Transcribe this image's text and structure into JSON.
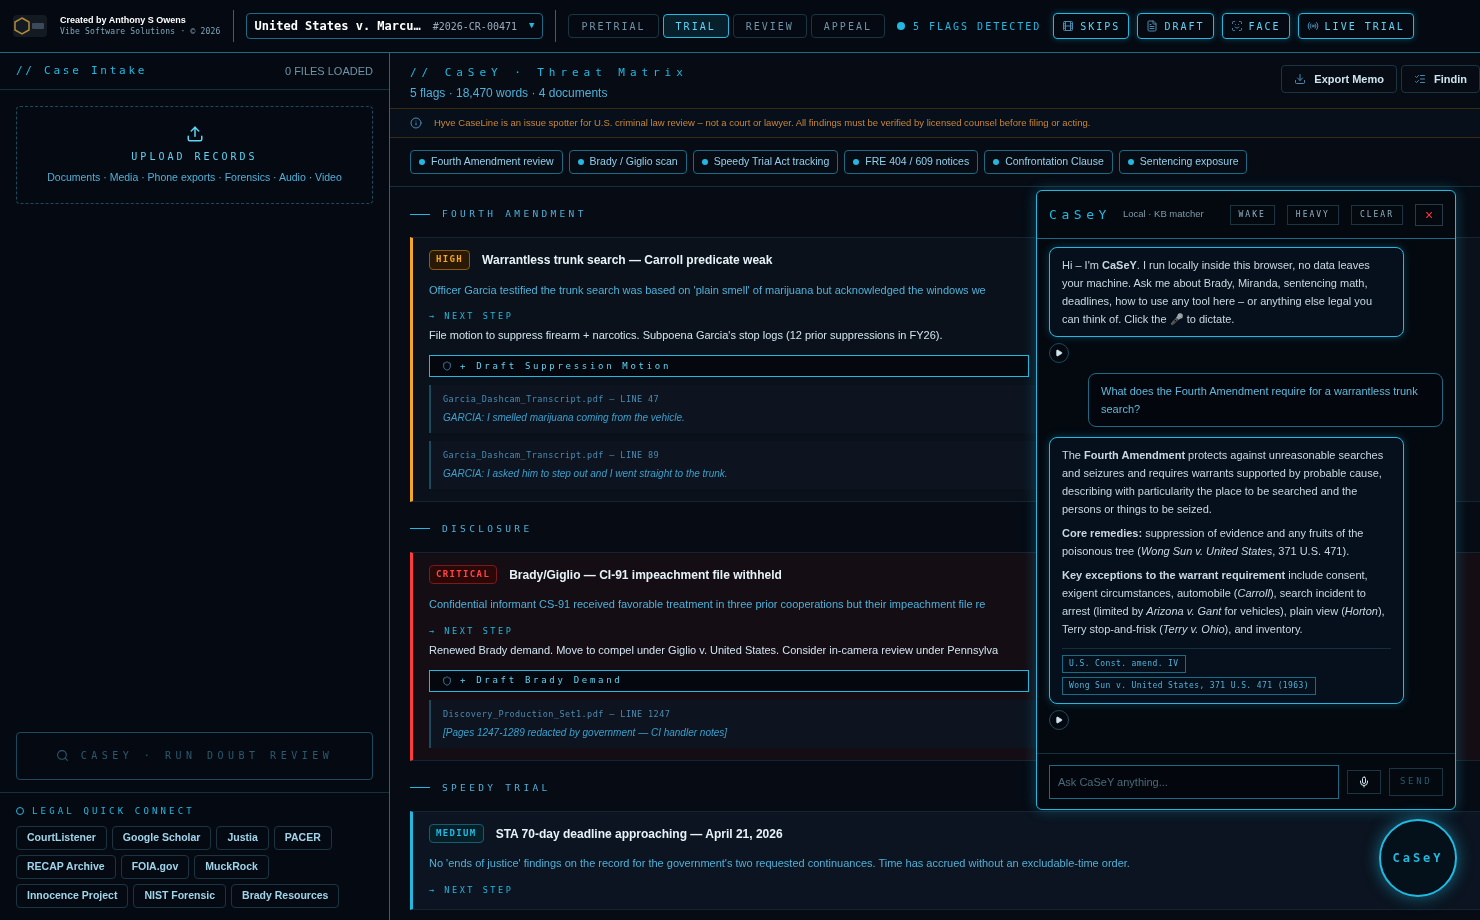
{
  "header": {
    "credit": "Created by Anthony S Owens",
    "company": "Vibe Software Solutions · © 2026",
    "case": {
      "name": "United States v. Marcu…",
      "number": "#2026-CR-00471",
      "caret": "▼"
    },
    "phases": [
      {
        "label": "PRETRIAL",
        "selected": false
      },
      {
        "label": "TRIAL",
        "selected": true
      },
      {
        "label": "REVIEW",
        "selected": false
      },
      {
        "label": "APPEAL",
        "selected": false
      }
    ],
    "flags": "5 FLAGS DETECTED",
    "tools": [
      {
        "kind": "skips",
        "label": "SKIPS"
      },
      {
        "kind": "draft",
        "label": "DRAFT"
      },
      {
        "kind": "face",
        "label": "FACE"
      },
      {
        "kind": "live",
        "label": "LIVE TRIAL"
      }
    ]
  },
  "sidebar": {
    "title": "// Case Intake",
    "files": "0 FILES LOADED",
    "upload": {
      "title": "UPLOAD RECORDS",
      "types": "Documents · Media · Phone exports · Forensics · Audio · Video"
    },
    "review_button": {
      "label": "CASEY · RUN DOUBT REVIEW",
      "disabled": true
    },
    "quick_connect": {
      "title": "LEGAL QUICK CONNECT",
      "links": [
        "CourtListener",
        "Google Scholar",
        "Justia",
        "PACER",
        "RECAP Archive",
        "FOIA.gov",
        "MuckRock",
        "Innocence Project",
        "NIST Forensic",
        "Brady Resources"
      ]
    }
  },
  "main": {
    "title": "// CaSeY · Threat Matrix",
    "stats": "5 flags · 18,470 words · 4 documents",
    "actions": [
      {
        "kind": "export",
        "label": "Export Memo"
      },
      {
        "kind": "findings",
        "label": "Findin"
      }
    ],
    "disclaimer": "Hyve CaseLine is an issue spotter for U.S. criminal law review – not a court or lawyer. All findings must be verified by licensed counsel before filing or acting.",
    "filters": [
      "Fourth Amendment review",
      "Brady / Giglio scan",
      "Speedy Trial Act tracking",
      "FRE 404 / 609 notices",
      "Confrontation Clause",
      "Sentencing exposure"
    ],
    "sections": [
      {
        "title": "FOURTH AMENDMENT",
        "findings": [
          {
            "kind": "high",
            "severity": "HIGH",
            "title": "Warrantless trunk search — Carroll predicate weak",
            "body": "Officer Garcia testified the trunk search was based on 'plain smell' of marijuana but acknowledged the windows we",
            "next_label": "→ NEXT STEP",
            "next": "File motion to suppress firearm + narcotics. Subpoena Garcia's stop logs (12 prior suppressions in FY26).",
            "draft": "+ Draft Suppression Motion",
            "evidence": [
              {
                "source": "Garcia_Dashcam_Transcript.pdf — LINE 47",
                "quote": "GARCIA: I smelled marijuana coming from the vehicle."
              },
              {
                "source": "Garcia_Dashcam_Transcript.pdf — LINE 89",
                "quote": "GARCIA: I asked him to step out and I went straight to the trunk."
              }
            ]
          }
        ]
      },
      {
        "title": "DISCLOSURE",
        "findings": [
          {
            "kind": "critical",
            "severity": "CRITICAL",
            "title": "Brady/Giglio — CI-91 impeachment file withheld",
            "body": "Confidential informant CS-91 received favorable treatment in three prior cooperations but their impeachment file re",
            "next_label": "→ NEXT STEP",
            "next": "Renewed Brady demand. Move to compel under Giglio v. United States. Consider in-camera review under Pennsylva",
            "draft": "+ Draft Brady Demand",
            "evidence": [
              {
                "source": "Discovery_Production_Set1.pdf — LINE 1247",
                "quote": "[Pages 1247-1289 redacted by government — CI handler notes]"
              }
            ]
          }
        ]
      },
      {
        "title": "SPEEDY TRIAL",
        "findings": [
          {
            "kind": "medium",
            "severity": "MEDIUM",
            "title": "STA 70-day deadline approaching — April 21, 2026",
            "body": "No 'ends of justice' findings on the record for the government's two requested continuances. Time has accrued without an excludable-time order.",
            "next_label": "→ NEXT STEP"
          }
        ]
      }
    ]
  },
  "chat": {
    "name": "CaSeY",
    "mode": "Local · KB matcher",
    "controls": [
      "WAKE",
      "HEAVY",
      "CLEAR"
    ],
    "close": "×",
    "messages": [
      {
        "kind": "assistant",
        "paragraphs": [
          "Hi – I'm **CaSeY**. I run locally inside this browser, no data leaves your machine. Ask me about Brady, Miranda, sentencing math, deadlines, how to use any tool here – or anything else legal you can think of. Click the 🎤 to dictate."
        ]
      },
      {
        "kind": "user",
        "paragraphs": [
          "What does the Fourth Amendment require for a warrantless trunk search?"
        ]
      },
      {
        "kind": "assistant",
        "paragraphs": [
          "The **Fourth Amendment** protects against unreasonable searches and seizures and requires warrants supported by probable cause, describing with particularity the place to be searched and the persons or things to be seized.",
          "**Core remedies:** suppression of evidence and any fruits of the poisonous tree (*Wong Sun v. United States*, 371 U.S. 471).",
          "**Key exceptions to the warrant requirement** include consent, exigent circumstances, automobile (*Carroll*), search incident to arrest (limited by *Arizona v. Gant* for vehicles), plain view (*Horton*), Terry stop-and-frisk (*Terry v. Ohio*), and inventory."
        ],
        "citations": [
          "U.S. Const. amend. IV",
          "Wong Sun v. United States, 371 U.S. 471 (1963)"
        ]
      }
    ],
    "input": {
      "placeholder": "Ask CaSeY anything..."
    },
    "send": "SEND"
  },
  "fab": "CaSeY"
}
